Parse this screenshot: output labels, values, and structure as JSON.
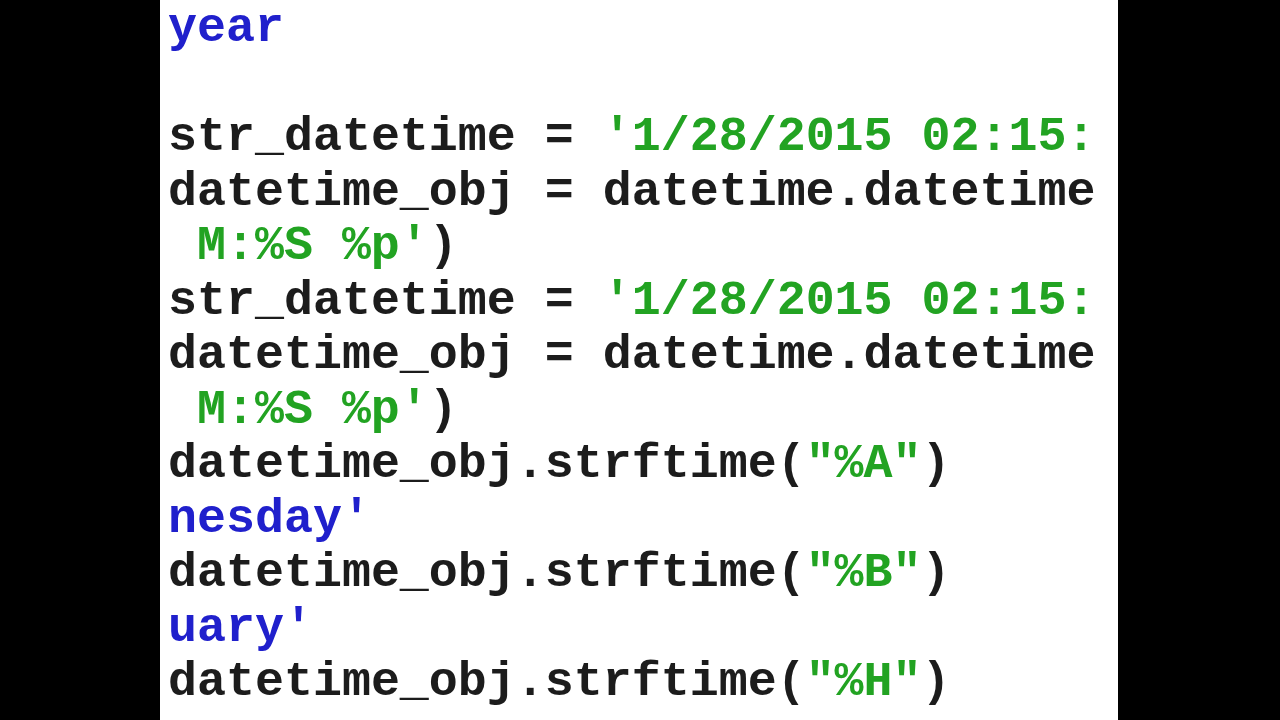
{
  "lines": [
    {
      "kind": "output",
      "tokens": [
        {
          "kind": "output",
          "text": "year"
        }
      ]
    },
    {
      "kind": "blank"
    },
    {
      "kind": "input",
      "tokens": [
        {
          "kind": "code",
          "text": "str_datetime = "
        },
        {
          "kind": "string",
          "text": "'1/28/2015 02:15:"
        }
      ]
    },
    {
      "kind": "input",
      "tokens": [
        {
          "kind": "code",
          "text": "datetime_obj = datetime.datetime"
        }
      ]
    },
    {
      "kind": "continuation",
      "tokens": [
        {
          "kind": "string",
          "text": "M:%S %p'"
        },
        {
          "kind": "code",
          "text": ")"
        }
      ]
    },
    {
      "kind": "input",
      "tokens": [
        {
          "kind": "code",
          "text": "str_datetime = "
        },
        {
          "kind": "string",
          "text": "'1/28/2015 02:15:"
        }
      ]
    },
    {
      "kind": "input",
      "tokens": [
        {
          "kind": "code",
          "text": "datetime_obj = datetime.datetime"
        }
      ]
    },
    {
      "kind": "continuation",
      "tokens": [
        {
          "kind": "string",
          "text": "M:%S %p'"
        },
        {
          "kind": "code",
          "text": ")"
        }
      ]
    },
    {
      "kind": "input",
      "tokens": [
        {
          "kind": "code",
          "text": "datetime_obj.strftime("
        },
        {
          "kind": "string",
          "text": "\"%A\""
        },
        {
          "kind": "code",
          "text": ")"
        }
      ]
    },
    {
      "kind": "output",
      "tokens": [
        {
          "kind": "output",
          "text": "nesday'"
        }
      ]
    },
    {
      "kind": "input",
      "tokens": [
        {
          "kind": "code",
          "text": "datetime_obj.strftime("
        },
        {
          "kind": "string",
          "text": "\"%B\""
        },
        {
          "kind": "code",
          "text": ")"
        }
      ]
    },
    {
      "kind": "output",
      "tokens": [
        {
          "kind": "output",
          "text": "uary'"
        }
      ]
    },
    {
      "kind": "input",
      "tokens": [
        {
          "kind": "code",
          "text": "datetime_obj.strftime("
        },
        {
          "kind": "string",
          "text": "\"%H\""
        },
        {
          "kind": "code",
          "text": ")"
        }
      ]
    }
  ]
}
